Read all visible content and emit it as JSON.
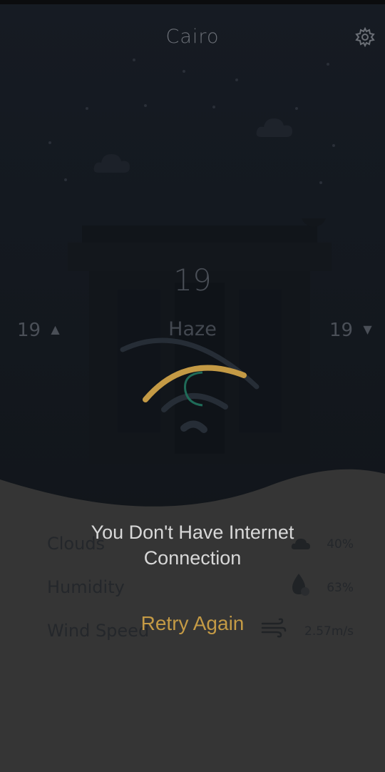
{
  "header": {
    "city": "Cairo",
    "settings_icon": "gear-icon"
  },
  "weather": {
    "temperature": "19",
    "condition": "Haze",
    "high": "19",
    "low": "19"
  },
  "details": [
    {
      "label": "Clouds",
      "value": "40%",
      "icon": "cloud-icon"
    },
    {
      "label": "Humidity",
      "value": "63%",
      "icon": "droplet-icon"
    },
    {
      "label": "Wind Speed",
      "value": "2.57m/s",
      "icon": "wind-icon"
    }
  ],
  "dialog": {
    "message_line1": "You Don't Have Internet",
    "message_line2": "Connection",
    "retry_label": "Retry Again"
  },
  "colors": {
    "accent": "#c49a45",
    "background": "#1a1d22",
    "panel": "#353535"
  }
}
